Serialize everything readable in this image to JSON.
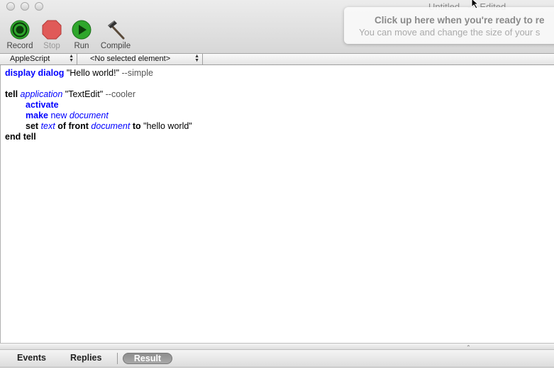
{
  "window": {
    "title": "Untitled",
    "title_status": "— Edited"
  },
  "toolbar": {
    "record_label": "Record",
    "stop_label": "Stop",
    "run_label": "Run",
    "compile_label": "Compile"
  },
  "tip": {
    "line1": "Click up here when you're ready to re",
    "line2": "You can move and change the size of your s"
  },
  "navbar": {
    "language": "AppleScript",
    "element": "<No selected element>"
  },
  "script": {
    "l1_cmd": "display dialog",
    "l1_str": "\"Hello world!\"",
    "l1_comment": "--simple",
    "l3_tell": "tell",
    "l3_class": "application",
    "l3_str": "\"TextEdit\"",
    "l3_comment": "--cooler",
    "l4_cmd": "activate",
    "l5_cmd": "make",
    "l5_new": "new",
    "l5_class": "document",
    "l6_set": "set",
    "l6_prop": "text",
    "l6_of": "of front",
    "l6_class": "document",
    "l6_to": "to",
    "l6_str": "\"hello world\"",
    "l7_end": "end tell"
  },
  "bottom_tabs": {
    "events": "Events",
    "replies": "Replies",
    "result": "Result",
    "selected": "Result"
  },
  "colors": {
    "keyword": "#0000ff",
    "record_green": "#2fa62c",
    "stop_red": "#e05a58",
    "run_green": "#2fa62c"
  }
}
